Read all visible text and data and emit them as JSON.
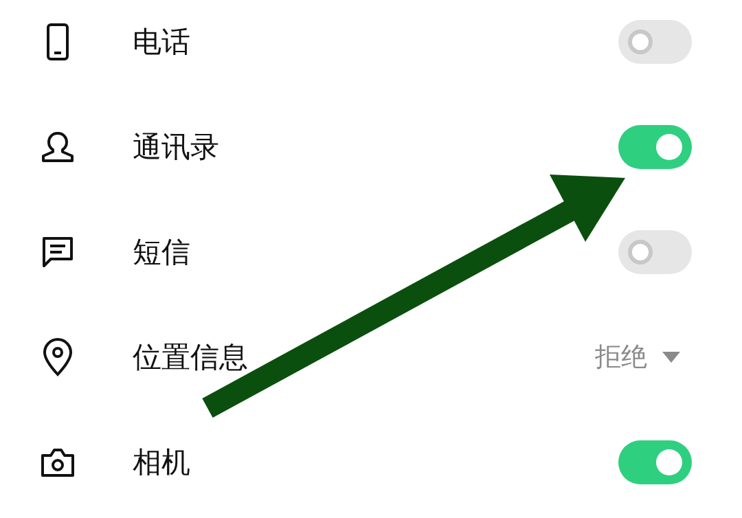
{
  "permissions": [
    {
      "kind": "toggle",
      "label": "电话",
      "on": false
    },
    {
      "kind": "toggle",
      "label": "通讯录",
      "on": true
    },
    {
      "kind": "toggle",
      "label": "短信",
      "on": false
    },
    {
      "kind": "dropdown",
      "label": "位置信息",
      "value": "拒绝"
    },
    {
      "kind": "toggle",
      "label": "相机",
      "on": true
    }
  ]
}
